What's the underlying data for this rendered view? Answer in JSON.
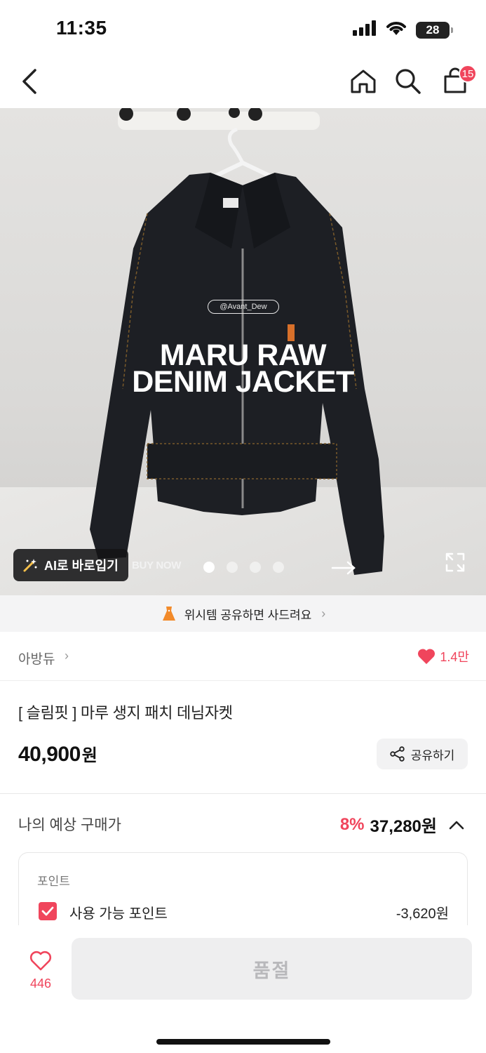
{
  "status_bar": {
    "time": "11:35",
    "battery": "28"
  },
  "nav": {
    "cart_badge": "15"
  },
  "hero": {
    "tag": "@Avant_Dew",
    "title_line1": "MARU RAW",
    "title_line2": "DENIM JACKET",
    "ai_button": "AI로 바로입기",
    "buy_now": "BUY NOW",
    "slides_total": 4,
    "slide_active": 1
  },
  "wish_banner": {
    "text": "위시템 공유하면 사드려요"
  },
  "brand": {
    "name": "아방듀",
    "likes": "1.4만"
  },
  "product": {
    "title": "[ 슬림핏 ] 마루 생지 패치 데님자켓",
    "price": "40,900",
    "price_unit": "원",
    "share_label": "공유하기"
  },
  "expected": {
    "label": "나의 예상 구매가",
    "discount": "8%",
    "price": "37,280원"
  },
  "points": {
    "title": "포인트",
    "label": "사용 가능 포인트",
    "value": "-3,620원"
  },
  "bottom": {
    "like_count": "446",
    "soldout_label": "품절"
  },
  "colors": {
    "accent": "#f0455c",
    "banner_bg": "#f4f4f5"
  }
}
